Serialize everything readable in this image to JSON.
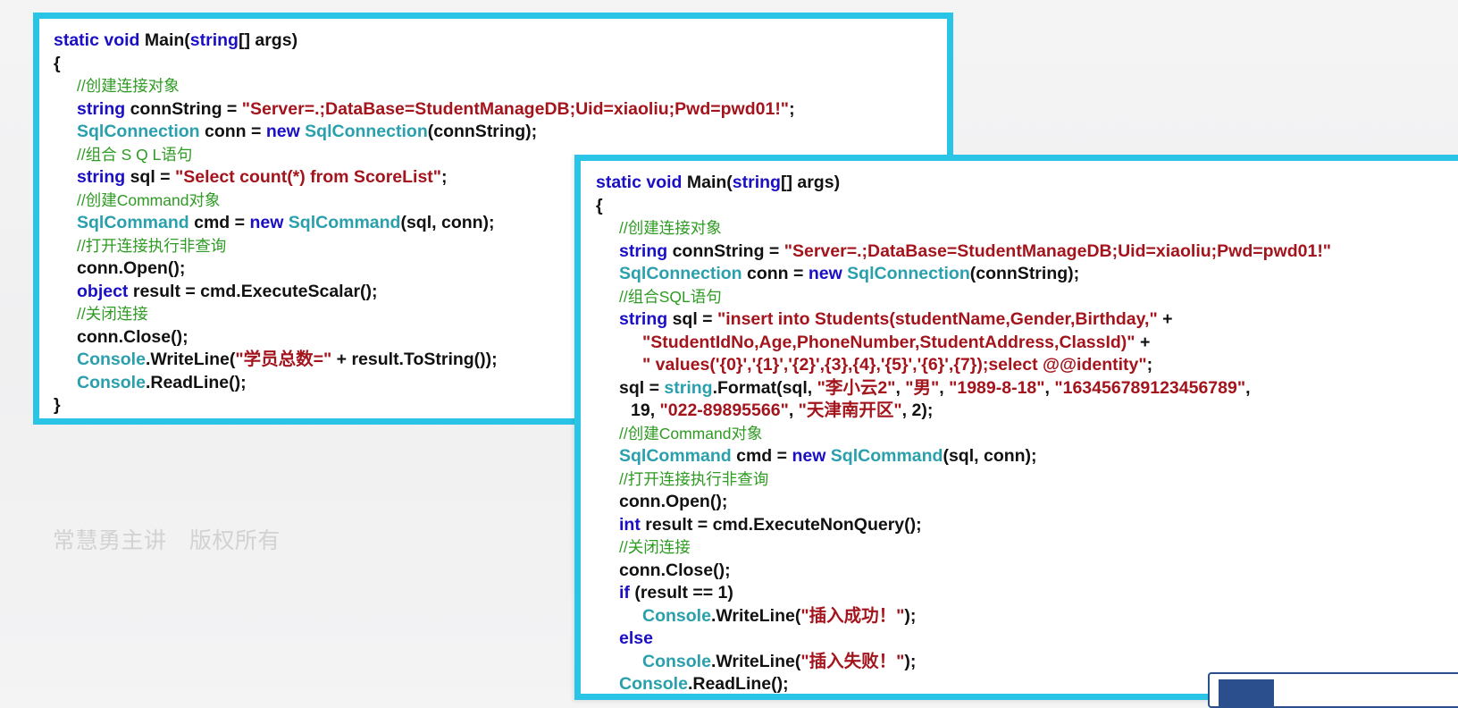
{
  "code_block_1": {
    "lines": [
      {
        "indent": 0,
        "tokens": [
          {
            "t": "static void ",
            "c": "kw"
          },
          {
            "t": "Main(",
            "c": "plain"
          },
          {
            "t": "string",
            "c": "kw"
          },
          {
            "t": "[] args)",
            "c": "plain"
          }
        ]
      },
      {
        "indent": 0,
        "tokens": [
          {
            "t": "{",
            "c": "plain"
          }
        ]
      },
      {
        "indent": 1,
        "tokens": [
          {
            "t": "//创建连接对象",
            "c": "cmt"
          }
        ]
      },
      {
        "indent": 1,
        "tokens": [
          {
            "t": "string",
            "c": "kw"
          },
          {
            "t": " connString = ",
            "c": "plain"
          },
          {
            "t": "\"Server=.;DataBase=StudentManageDB;Uid=xiaoliu;Pwd=pwd01!\"",
            "c": "str"
          },
          {
            "t": ";",
            "c": "plain"
          }
        ]
      },
      {
        "indent": 1,
        "tokens": [
          {
            "t": "SqlConnection",
            "c": "type"
          },
          {
            "t": " conn = ",
            "c": "plain"
          },
          {
            "t": "new ",
            "c": "kw"
          },
          {
            "t": "SqlConnection",
            "c": "type"
          },
          {
            "t": "(connString);",
            "c": "plain"
          }
        ]
      },
      {
        "indent": 1,
        "tokens": [
          {
            "t": "//组合 S Q L语句",
            "c": "cmt"
          }
        ]
      },
      {
        "indent": 1,
        "tokens": [
          {
            "t": "string",
            "c": "kw"
          },
          {
            "t": " sql = ",
            "c": "plain"
          },
          {
            "t": "\"Select count(*) from ScoreList\"",
            "c": "str"
          },
          {
            "t": ";",
            "c": "plain"
          }
        ]
      },
      {
        "indent": 1,
        "tokens": [
          {
            "t": "//创建Command对象",
            "c": "cmt"
          }
        ]
      },
      {
        "indent": 1,
        "tokens": [
          {
            "t": "SqlCommand",
            "c": "type"
          },
          {
            "t": " cmd = ",
            "c": "plain"
          },
          {
            "t": "new ",
            "c": "kw"
          },
          {
            "t": "SqlCommand",
            "c": "type"
          },
          {
            "t": "(sql, conn);",
            "c": "plain"
          }
        ]
      },
      {
        "indent": 1,
        "tokens": [
          {
            "t": "//打开连接执行非查询",
            "c": "cmt"
          }
        ]
      },
      {
        "indent": 1,
        "tokens": [
          {
            "t": "conn.Open();",
            "c": "plain"
          }
        ]
      },
      {
        "indent": 1,
        "tokens": [
          {
            "t": "object",
            "c": "kw"
          },
          {
            "t": " result = cmd.ExecuteScalar();",
            "c": "plain"
          }
        ]
      },
      {
        "indent": 1,
        "tokens": [
          {
            "t": "//关闭连接",
            "c": "cmt"
          }
        ]
      },
      {
        "indent": 1,
        "tokens": [
          {
            "t": "conn.Close();",
            "c": "plain"
          }
        ]
      },
      {
        "indent": 1,
        "tokens": [
          {
            "t": "Console",
            "c": "type"
          },
          {
            "t": ".WriteLine(",
            "c": "plain"
          },
          {
            "t": "\"学员总数=\"",
            "c": "str"
          },
          {
            "t": " + result.ToString());",
            "c": "plain"
          }
        ]
      },
      {
        "indent": 1,
        "tokens": [
          {
            "t": "Console",
            "c": "type"
          },
          {
            "t": ".ReadLine();",
            "c": "plain"
          }
        ]
      },
      {
        "indent": 0,
        "tokens": [
          {
            "t": "}",
            "c": "plain"
          }
        ]
      }
    ]
  },
  "code_block_2": {
    "lines": [
      {
        "indent": 0,
        "tokens": [
          {
            "t": "static void ",
            "c": "kw"
          },
          {
            "t": "Main(",
            "c": "plain"
          },
          {
            "t": "string",
            "c": "kw"
          },
          {
            "t": "[] args)",
            "c": "plain"
          }
        ]
      },
      {
        "indent": 0,
        "tokens": [
          {
            "t": "{",
            "c": "plain"
          }
        ]
      },
      {
        "indent": 1,
        "tokens": [
          {
            "t": "//创建连接对象",
            "c": "cmt"
          }
        ]
      },
      {
        "indent": 1,
        "tokens": [
          {
            "t": "string",
            "c": "kw"
          },
          {
            "t": " connString = ",
            "c": "plain"
          },
          {
            "t": "\"Server=.;DataBase=StudentManageDB;Uid=xiaoliu;Pwd=pwd01!\"",
            "c": "str"
          }
        ]
      },
      {
        "indent": 1,
        "tokens": [
          {
            "t": "SqlConnection",
            "c": "type"
          },
          {
            "t": " conn = ",
            "c": "plain"
          },
          {
            "t": "new ",
            "c": "kw"
          },
          {
            "t": "SqlConnection",
            "c": "type"
          },
          {
            "t": "(connString);",
            "c": "plain"
          }
        ]
      },
      {
        "indent": 1,
        "tokens": [
          {
            "t": "//组合SQL语句",
            "c": "cmt"
          }
        ]
      },
      {
        "indent": 1,
        "tokens": [
          {
            "t": "string",
            "c": "kw"
          },
          {
            "t": " sql = ",
            "c": "plain"
          },
          {
            "t": "\"insert into Students(studentName,Gender,Birthday,\"",
            "c": "str"
          },
          {
            "t": " +",
            "c": "plain"
          }
        ]
      },
      {
        "indent": 2,
        "tokens": [
          {
            "t": "\"StudentIdNo,Age,PhoneNumber,StudentAddress,ClassId)\"",
            "c": "str"
          },
          {
            "t": " +",
            "c": "plain"
          }
        ]
      },
      {
        "indent": 2,
        "tokens": [
          {
            "t": "\" values('{0}','{1}','{2}',{3},{4},'{5}','{6}',{7});select @@identity\"",
            "c": "str"
          },
          {
            "t": ";",
            "c": "plain"
          }
        ]
      },
      {
        "indent": 1,
        "tokens": [
          {
            "t": "sql = ",
            "c": "plain"
          },
          {
            "t": "string",
            "c": "type"
          },
          {
            "t": ".Format(sql, ",
            "c": "plain"
          },
          {
            "t": "\"李小云2\"",
            "c": "str"
          },
          {
            "t": ", ",
            "c": "plain"
          },
          {
            "t": "\"男\"",
            "c": "str"
          },
          {
            "t": ", ",
            "c": "plain"
          },
          {
            "t": "\"1989-8-18\"",
            "c": "str"
          },
          {
            "t": ", ",
            "c": "plain"
          },
          {
            "t": "\"163456789123456789\"",
            "c": "str"
          },
          {
            "t": ",",
            "c": "plain"
          }
        ]
      },
      {
        "indent": 1.5,
        "tokens": [
          {
            "t": "19, ",
            "c": "plain"
          },
          {
            "t": "\"022-89895566\"",
            "c": "str"
          },
          {
            "t": ", ",
            "c": "plain"
          },
          {
            "t": "\"天津南开区\"",
            "c": "str"
          },
          {
            "t": ", 2);",
            "c": "plain"
          }
        ]
      },
      {
        "indent": 1,
        "tokens": [
          {
            "t": "//创建Command对象",
            "c": "cmt"
          }
        ]
      },
      {
        "indent": 1,
        "tokens": [
          {
            "t": "SqlCommand",
            "c": "type"
          },
          {
            "t": " cmd = ",
            "c": "plain"
          },
          {
            "t": "new ",
            "c": "kw"
          },
          {
            "t": "SqlCommand",
            "c": "type"
          },
          {
            "t": "(sql, conn);",
            "c": "plain"
          }
        ]
      },
      {
        "indent": 1,
        "tokens": [
          {
            "t": "//打开连接执行非查询",
            "c": "cmt"
          }
        ]
      },
      {
        "indent": 1,
        "tokens": [
          {
            "t": "conn.Open();",
            "c": "plain"
          }
        ]
      },
      {
        "indent": 1,
        "tokens": [
          {
            "t": "int",
            "c": "kw"
          },
          {
            "t": " result = cmd.ExecuteNonQuery();",
            "c": "plain"
          }
        ]
      },
      {
        "indent": 1,
        "tokens": [
          {
            "t": "//关闭连接",
            "c": "cmt"
          }
        ]
      },
      {
        "indent": 1,
        "tokens": [
          {
            "t": "conn.Close();",
            "c": "plain"
          }
        ]
      },
      {
        "indent": 1,
        "tokens": [
          {
            "t": "if",
            "c": "kw"
          },
          {
            "t": " (result == 1)",
            "c": "plain"
          }
        ]
      },
      {
        "indent": 2,
        "tokens": [
          {
            "t": "Console",
            "c": "type"
          },
          {
            "t": ".WriteLine(",
            "c": "plain"
          },
          {
            "t": "\"插入成功！\"",
            "c": "str"
          },
          {
            "t": ");",
            "c": "plain"
          }
        ]
      },
      {
        "indent": 1,
        "tokens": [
          {
            "t": "else",
            "c": "kw"
          }
        ]
      },
      {
        "indent": 2,
        "tokens": [
          {
            "t": "Console",
            "c": "type"
          },
          {
            "t": ".WriteLine(",
            "c": "plain"
          },
          {
            "t": "\"插入失败！\"",
            "c": "str"
          },
          {
            "t": ");",
            "c": "plain"
          }
        ]
      },
      {
        "indent": 1,
        "tokens": [
          {
            "t": "Console",
            "c": "type"
          },
          {
            "t": ".ReadLine();",
            "c": "plain"
          }
        ]
      }
    ]
  },
  "watermark": {
    "text": "常慧勇主讲   版权所有"
  },
  "colors": {
    "keyword": "#1a0fc4",
    "type": "#2aa0ad",
    "string": "#a3141c",
    "comment": "#2e9b22",
    "plain": "#111111",
    "frame_border": "#29c4e6",
    "logo_blue": "#2a4f8c"
  }
}
